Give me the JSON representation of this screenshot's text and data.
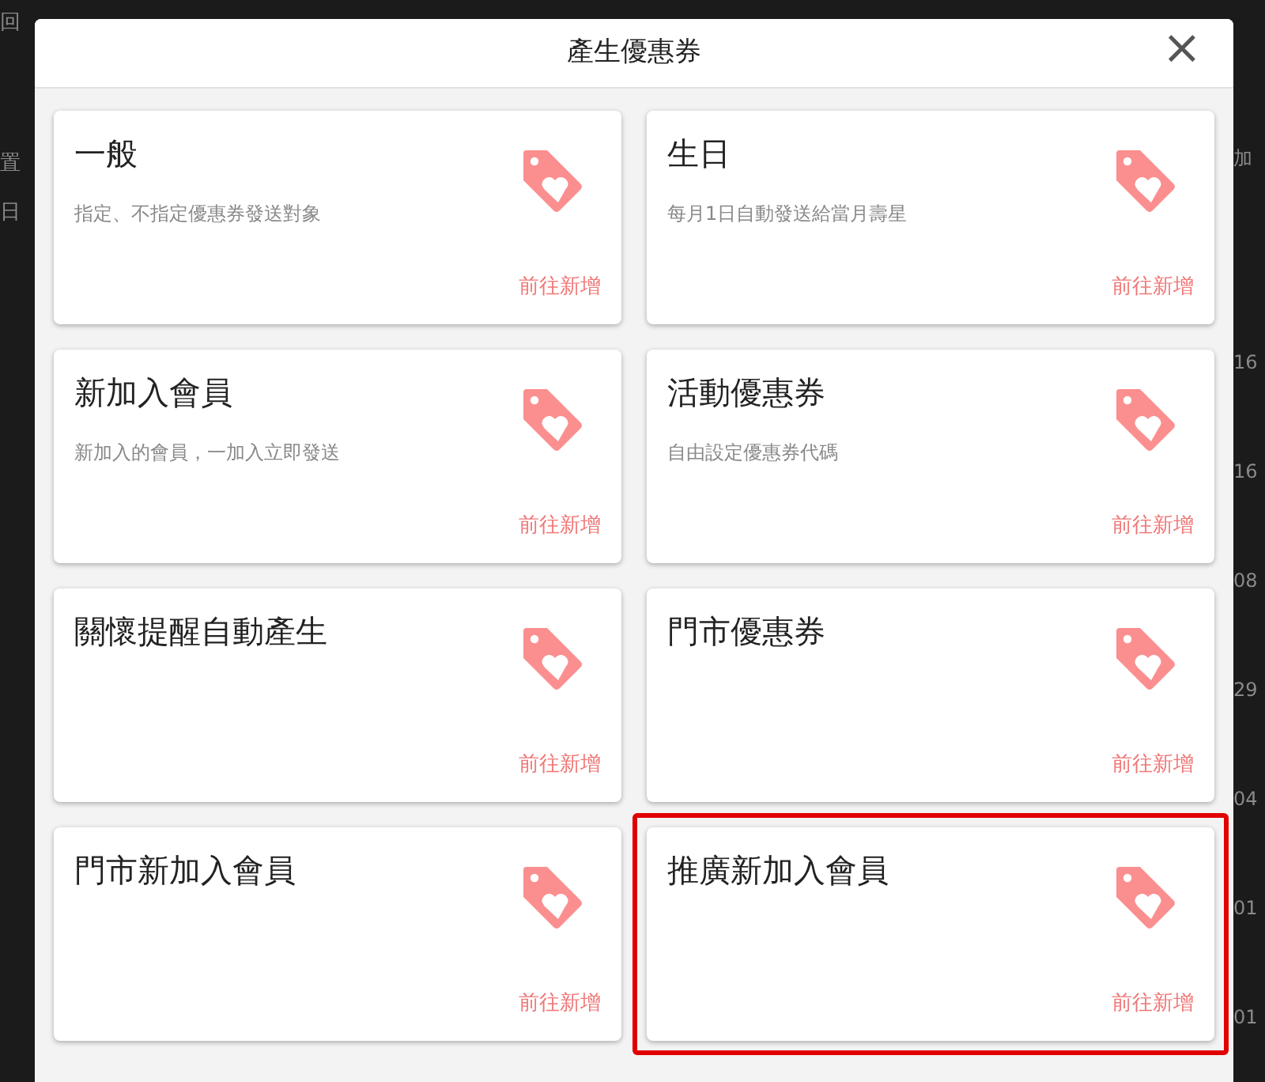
{
  "background": {
    "left_texts": [
      "回",
      "置",
      "日"
    ],
    "right_texts": [
      "加",
      "16",
      "16",
      "08",
      "29",
      "04",
      "01",
      "01"
    ]
  },
  "dialog": {
    "title": "產生優惠券",
    "close": "×",
    "cards": [
      {
        "title": "一般",
        "description": "指定、不指定優惠券發送對象",
        "action": "前往新增",
        "highlighted": false
      },
      {
        "title": "生日",
        "description": "每月1日自動發送給當月壽星",
        "action": "前往新增",
        "highlighted": false
      },
      {
        "title": "新加入會員",
        "description": "新加入的會員，一加入立即發送",
        "action": "前往新增",
        "highlighted": false
      },
      {
        "title": "活動優惠券",
        "description": "自由設定優惠券代碼",
        "action": "前往新增",
        "highlighted": false
      },
      {
        "title": "關懷提醒自動產生",
        "action": "前往新增",
        "highlighted": false
      },
      {
        "title": "門市優惠券",
        "action": "前往新增",
        "highlighted": false
      },
      {
        "title": "門市新加入會員",
        "action": "前往新增",
        "highlighted": false
      },
      {
        "title": "推廣新加入會員",
        "action": "前往新增",
        "highlighted": true
      }
    ]
  }
}
